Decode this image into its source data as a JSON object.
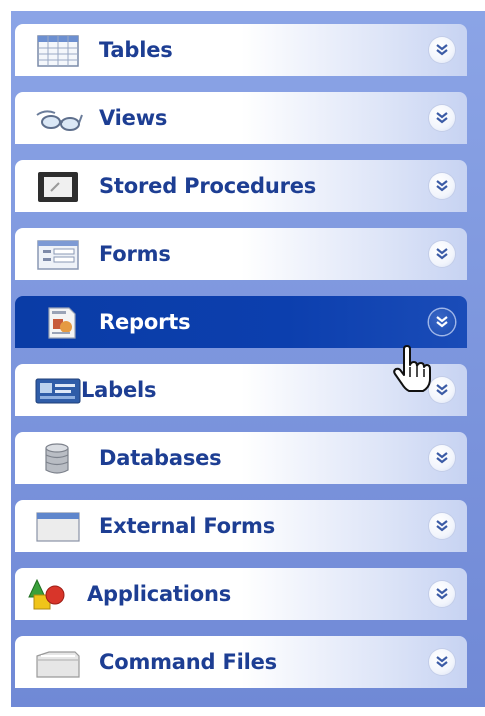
{
  "panel": {
    "items": [
      {
        "label": "Tables",
        "icon": "table-icon"
      },
      {
        "label": "Views",
        "icon": "glasses-icon"
      },
      {
        "label": "Stored Procedures",
        "icon": "display-icon"
      },
      {
        "label": "Forms",
        "icon": "form-icon"
      },
      {
        "label": "Reports",
        "icon": "report-icon"
      },
      {
        "label": "Labels",
        "icon": "label-card-icon"
      },
      {
        "label": "Databases",
        "icon": "database-icon"
      },
      {
        "label": "External Forms",
        "icon": "window-icon"
      },
      {
        "label": "Applications",
        "icon": "shapes-icon"
      },
      {
        "label": "Command Files",
        "icon": "folder-icon"
      }
    ],
    "active_item": "Reports"
  },
  "colors": {
    "panel_background": "#7e97de",
    "item_text": "#1d3e93",
    "active_background": "#0c3fae",
    "active_text": "#ffffff"
  }
}
